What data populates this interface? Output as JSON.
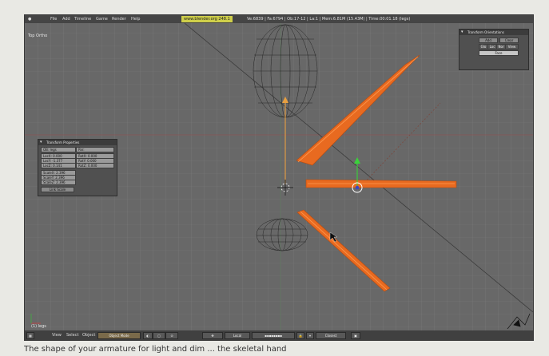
{
  "menubar": {
    "items": [
      "File",
      "Add",
      "Timeline",
      "Game",
      "Render",
      "Help"
    ],
    "url": "www.blender.org 248.1",
    "stats": "Ve:6839 | Fa:6794 | Ob:17-12 | La:1 | Mem:6.81M (15.43M) | Time:00:01.18 (legs)"
  },
  "viewport": {
    "view_label": "Top Ortho",
    "object_label": "(1) legs"
  },
  "transform_panel": {
    "title": "Transform Properties",
    "ob_label": "OB: legs",
    "par_label": "Par:",
    "loc": [
      "LocX: 0.000",
      "LocY: -1.377",
      "LocZ: 0.141"
    ],
    "rot": [
      "RotX: 0.000",
      "RotY: 0.000",
      "RotZ: 0.000"
    ],
    "scale": [
      "ScaleX: 2.396",
      "ScaleY: 2.396",
      "ScaleZ: 2.396"
    ],
    "link_scale": "Link Scale"
  },
  "orientation_panel": {
    "title": "Transform Orientations",
    "add_label": "Add",
    "clear_label": "Clear",
    "options": [
      "Glo",
      "Loc",
      "Nor",
      "View"
    ],
    "selected": "Face"
  },
  "statusbar": {
    "view": "View",
    "select": "Select",
    "object": "Object",
    "mode": "Object Mode",
    "orientation": "Local",
    "snap": "Closest"
  },
  "caption": "The shape of your armature for light and dim ... the skeletal hand"
}
